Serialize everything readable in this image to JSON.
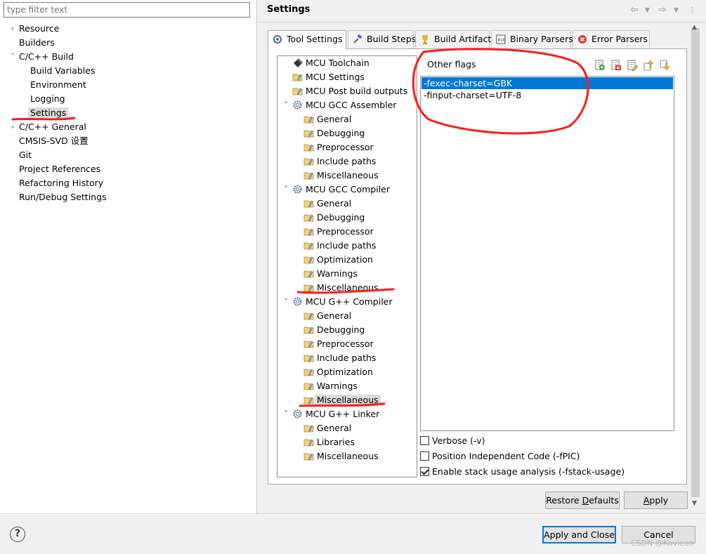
{
  "filter": {
    "placeholder": "type filter text"
  },
  "nav": [
    {
      "label": "Resource",
      "indent": 0,
      "chevron": "›"
    },
    {
      "label": "Builders",
      "indent": 0,
      "chevron": ""
    },
    {
      "label": "C/C++ Build",
      "indent": 0,
      "chevron": "˅"
    },
    {
      "label": "Build Variables",
      "indent": 1,
      "chevron": ""
    },
    {
      "label": "Environment",
      "indent": 1,
      "chevron": ""
    },
    {
      "label": "Logging",
      "indent": 1,
      "chevron": ""
    },
    {
      "label": "Settings",
      "indent": 1,
      "chevron": "",
      "selected": true
    },
    {
      "label": "C/C++ General",
      "indent": 0,
      "chevron": "›"
    },
    {
      "label": "CMSIS-SVD 设置",
      "indent": 0,
      "chevron": ""
    },
    {
      "label": "Git",
      "indent": 0,
      "chevron": ""
    },
    {
      "label": "Project References",
      "indent": 0,
      "chevron": ""
    },
    {
      "label": "Refactoring History",
      "indent": 0,
      "chevron": ""
    },
    {
      "label": "Run/Debug Settings",
      "indent": 0,
      "chevron": ""
    }
  ],
  "page": {
    "title": "Settings"
  },
  "tabs": [
    {
      "label": "Tool Settings",
      "icon": "tool-settings-icon",
      "active": true
    },
    {
      "label": "Build Steps",
      "icon": "build-steps-icon"
    },
    {
      "label": "Build Artifact",
      "icon": "trophy-icon"
    },
    {
      "label": "Binary Parsers",
      "icon": "binary-icon"
    },
    {
      "label": "Error Parsers",
      "icon": "error-icon"
    }
  ],
  "tree": [
    {
      "label": "MCU Toolchain",
      "indent": 0,
      "icon": "chip",
      "chevron": ""
    },
    {
      "label": "MCU Settings",
      "indent": 0,
      "icon": "folder",
      "chevron": ""
    },
    {
      "label": "MCU Post build outputs",
      "indent": 0,
      "icon": "folder",
      "chevron": ""
    },
    {
      "label": "MCU GCC Assembler",
      "indent": 0,
      "icon": "gear",
      "chevron": "˅"
    },
    {
      "label": "General",
      "indent": 1,
      "icon": "folder"
    },
    {
      "label": "Debugging",
      "indent": 1,
      "icon": "folder"
    },
    {
      "label": "Preprocessor",
      "indent": 1,
      "icon": "folder"
    },
    {
      "label": "Include paths",
      "indent": 1,
      "icon": "folder"
    },
    {
      "label": "Miscellaneous",
      "indent": 1,
      "icon": "folder"
    },
    {
      "label": "MCU GCC Compiler",
      "indent": 0,
      "icon": "gear",
      "chevron": "˅"
    },
    {
      "label": "General",
      "indent": 1,
      "icon": "folder"
    },
    {
      "label": "Debugging",
      "indent": 1,
      "icon": "folder"
    },
    {
      "label": "Preprocessor",
      "indent": 1,
      "icon": "folder"
    },
    {
      "label": "Include paths",
      "indent": 1,
      "icon": "folder"
    },
    {
      "label": "Optimization",
      "indent": 1,
      "icon": "folder"
    },
    {
      "label": "Warnings",
      "indent": 1,
      "icon": "folder"
    },
    {
      "label": "Miscellaneous",
      "indent": 1,
      "icon": "folder"
    },
    {
      "label": "MCU G++ Compiler",
      "indent": 0,
      "icon": "gear",
      "chevron": "˅"
    },
    {
      "label": "General",
      "indent": 1,
      "icon": "folder"
    },
    {
      "label": "Debugging",
      "indent": 1,
      "icon": "folder"
    },
    {
      "label": "Preprocessor",
      "indent": 1,
      "icon": "folder"
    },
    {
      "label": "Include paths",
      "indent": 1,
      "icon": "folder"
    },
    {
      "label": "Optimization",
      "indent": 1,
      "icon": "folder"
    },
    {
      "label": "Warnings",
      "indent": 1,
      "icon": "folder"
    },
    {
      "label": "Miscellaneous",
      "indent": 1,
      "icon": "folder",
      "selected": true
    },
    {
      "label": "MCU G++ Linker",
      "indent": 0,
      "icon": "gear",
      "chevron": "˅"
    },
    {
      "label": "General",
      "indent": 1,
      "icon": "folder"
    },
    {
      "label": "Libraries",
      "indent": 1,
      "icon": "folder"
    },
    {
      "label": "Miscellaneous",
      "indent": 1,
      "icon": "folder"
    }
  ],
  "flags": {
    "label": "Other flags",
    "items": [
      {
        "value": "-fexec-charset=GBK",
        "selected": true
      },
      {
        "value": "-finput-charset=UTF-8"
      }
    ]
  },
  "options": [
    {
      "label": "Verbose (-v)",
      "checked": false
    },
    {
      "label": "Position Independent Code (-fPIC)",
      "checked": false
    },
    {
      "label": "Enable stack usage analysis (-fstack-usage)",
      "checked": true
    }
  ],
  "buttons": {
    "restore_pre": "Restore ",
    "restore_mn": "D",
    "restore_post": "efaults",
    "apply_mn": "A",
    "apply_post": "pply",
    "apply_close": "Apply and Close",
    "cancel": "Cancel"
  },
  "watermark": "CSDN @Kavieen",
  "colors": {
    "selection": "#0078d7",
    "annotation": "#ff1a1a"
  }
}
